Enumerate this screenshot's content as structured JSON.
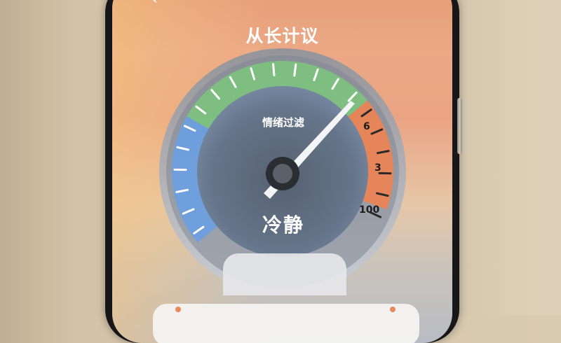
{
  "app": {
    "title": "从长计议"
  },
  "gauge": {
    "label": "情绪过滤",
    "mode": "冷静",
    "scale_labels": [
      "6",
      "3",
      "100"
    ],
    "colors": {
      "cool": "#6aa0e2",
      "calm": "#7cc47e",
      "warm": "#f08352",
      "face": "#5e6b7d",
      "needle": "#f3f4f6"
    }
  }
}
